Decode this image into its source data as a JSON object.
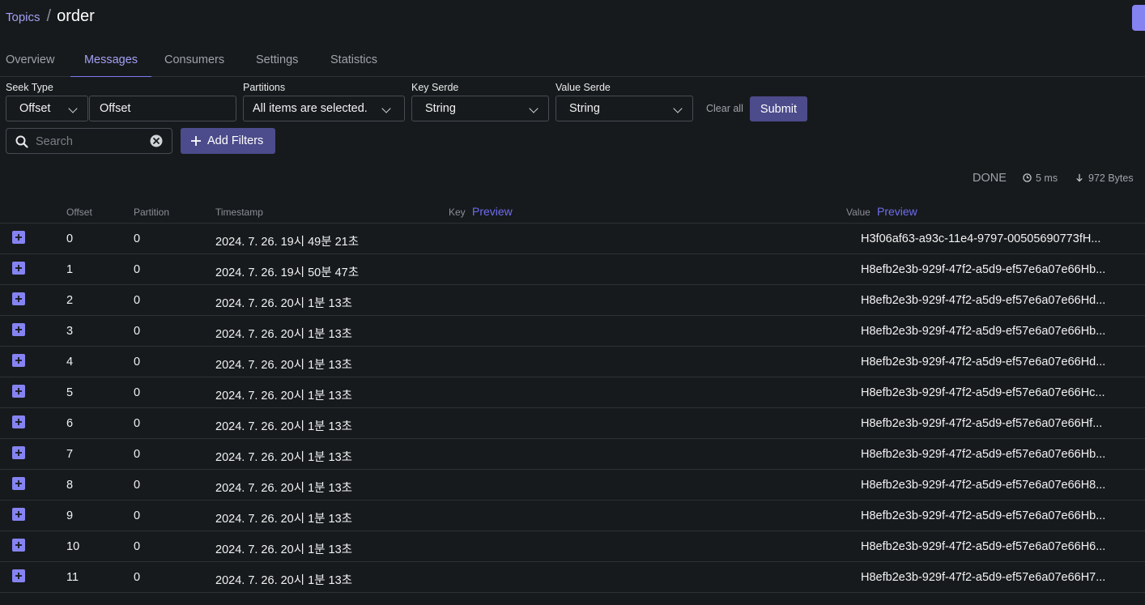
{
  "breadcrumb": {
    "parent": "Topics",
    "separator": "/",
    "current": "order"
  },
  "tabs": [
    {
      "label": "Overview",
      "active": false
    },
    {
      "label": "Messages",
      "active": true
    },
    {
      "label": "Consumers",
      "active": false
    },
    {
      "label": "Settings",
      "active": false
    },
    {
      "label": "Statistics",
      "active": false
    }
  ],
  "filters": {
    "seek_type_label": "Seek Type",
    "seek_type_value": "Offset",
    "seek_offset_value": "Offset",
    "partitions_label": "Partitions",
    "partitions_value": "All items are selected.",
    "key_serde_label": "Key Serde",
    "key_serde_value": "String",
    "value_serde_label": "Value Serde",
    "value_serde_value": "String",
    "clear_all_label": "Clear all",
    "submit_label": "Submit",
    "search_placeholder": "Search",
    "add_filters_label": "Add Filters"
  },
  "stats": {
    "status": "DONE",
    "elapsed": "5 ms",
    "bytes": "972 Bytes"
  },
  "table": {
    "headers": {
      "offset": "Offset",
      "partition": "Partition",
      "timestamp": "Timestamp",
      "key": "Key",
      "key_preview": "Preview",
      "value": "Value",
      "value_preview": "Preview"
    },
    "rows": [
      {
        "offset": "0",
        "partition": "0",
        "timestamp": "2024. 7. 26. 19시 49분 21초",
        "key": "",
        "value": "H3f06af63-a93c-11e4-9797-00505690773fH..."
      },
      {
        "offset": "1",
        "partition": "0",
        "timestamp": "2024. 7. 26. 19시 50분 47초",
        "key": "",
        "value": "H8efb2e3b-929f-47f2-a5d9-ef57e6a07e66Hb..."
      },
      {
        "offset": "2",
        "partition": "0",
        "timestamp": "2024. 7. 26. 20시 1분 13초",
        "key": "",
        "value": "H8efb2e3b-929f-47f2-a5d9-ef57e6a07e66Hd..."
      },
      {
        "offset": "3",
        "partition": "0",
        "timestamp": "2024. 7. 26. 20시 1분 13초",
        "key": "",
        "value": "H8efb2e3b-929f-47f2-a5d9-ef57e6a07e66Hb..."
      },
      {
        "offset": "4",
        "partition": "0",
        "timestamp": "2024. 7. 26. 20시 1분 13초",
        "key": "",
        "value": "H8efb2e3b-929f-47f2-a5d9-ef57e6a07e66Hd..."
      },
      {
        "offset": "5",
        "partition": "0",
        "timestamp": "2024. 7. 26. 20시 1분 13초",
        "key": "",
        "value": "H8efb2e3b-929f-47f2-a5d9-ef57e6a07e66Hc..."
      },
      {
        "offset": "6",
        "partition": "0",
        "timestamp": "2024. 7. 26. 20시 1분 13초",
        "key": "",
        "value": "H8efb2e3b-929f-47f2-a5d9-ef57e6a07e66Hf..."
      },
      {
        "offset": "7",
        "partition": "0",
        "timestamp": "2024. 7. 26. 20시 1분 13초",
        "key": "",
        "value": "H8efb2e3b-929f-47f2-a5d9-ef57e6a07e66Hb..."
      },
      {
        "offset": "8",
        "partition": "0",
        "timestamp": "2024. 7. 26. 20시 1분 13초",
        "key": "",
        "value": "H8efb2e3b-929f-47f2-a5d9-ef57e6a07e66H8..."
      },
      {
        "offset": "9",
        "partition": "0",
        "timestamp": "2024. 7. 26. 20시 1분 13초",
        "key": "",
        "value": "H8efb2e3b-929f-47f2-a5d9-ef57e6a07e66Hb..."
      },
      {
        "offset": "10",
        "partition": "0",
        "timestamp": "2024. 7. 26. 20시 1분 13초",
        "key": "",
        "value": "H8efb2e3b-929f-47f2-a5d9-ef57e6a07e66H6..."
      },
      {
        "offset": "11",
        "partition": "0",
        "timestamp": "2024. 7. 26. 20시 1분 13초",
        "key": "",
        "value": "H8efb2e3b-929f-47f2-a5d9-ef57e6a07e66H7..."
      }
    ]
  },
  "icons": {
    "search": "search-icon",
    "clear": "clear-circle-icon",
    "plus": "plus-icon",
    "clock": "clock-icon",
    "arrow_down": "arrow-down-icon",
    "chevron": "chevron-down-icon",
    "expand": "expand-plus-icon"
  },
  "colors": {
    "background": "#171a1c",
    "accent": "#8583f2",
    "accent_text": "#a3a0f5",
    "preview_link": "#6f6cf0",
    "button": "#4c4b8b",
    "border": "#484b52",
    "divider": "#2e3135"
  }
}
